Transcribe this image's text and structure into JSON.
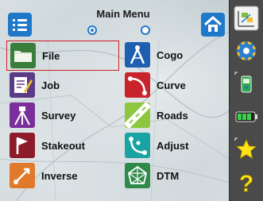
{
  "header": {
    "title": "Main Menu",
    "pages": [
      {
        "active": true
      },
      {
        "active": false
      }
    ]
  },
  "menu": {
    "items": [
      {
        "label": "File",
        "icon": "folder-icon",
        "selected": true
      },
      {
        "label": "Cogo",
        "icon": "compass-icon",
        "selected": false
      },
      {
        "label": "Job",
        "icon": "job-edit-icon",
        "selected": false
      },
      {
        "label": "Curve",
        "icon": "curve-icon",
        "selected": false
      },
      {
        "label": "Survey",
        "icon": "tripod-icon",
        "selected": false
      },
      {
        "label": "Roads",
        "icon": "road-icon",
        "selected": false
      },
      {
        "label": "Stakeout",
        "icon": "stake-flag-icon",
        "selected": false
      },
      {
        "label": "Adjust",
        "icon": "adjust-icon",
        "selected": false
      },
      {
        "label": "Inverse",
        "icon": "inverse-arrow-icon",
        "selected": false
      },
      {
        "label": "DTM",
        "icon": "dtm-mesh-icon",
        "selected": false
      }
    ]
  },
  "sidebar": {
    "buttons": [
      "map-view-icon",
      "settings-gear-icon",
      "gps-receiver-icon",
      "battery-icon",
      "favorites-star-icon",
      "help-question-icon"
    ]
  },
  "colors": {
    "accent": "#1f78c8",
    "selection_border": "#d02020",
    "sidebar_bg": "#4a4a4a"
  }
}
